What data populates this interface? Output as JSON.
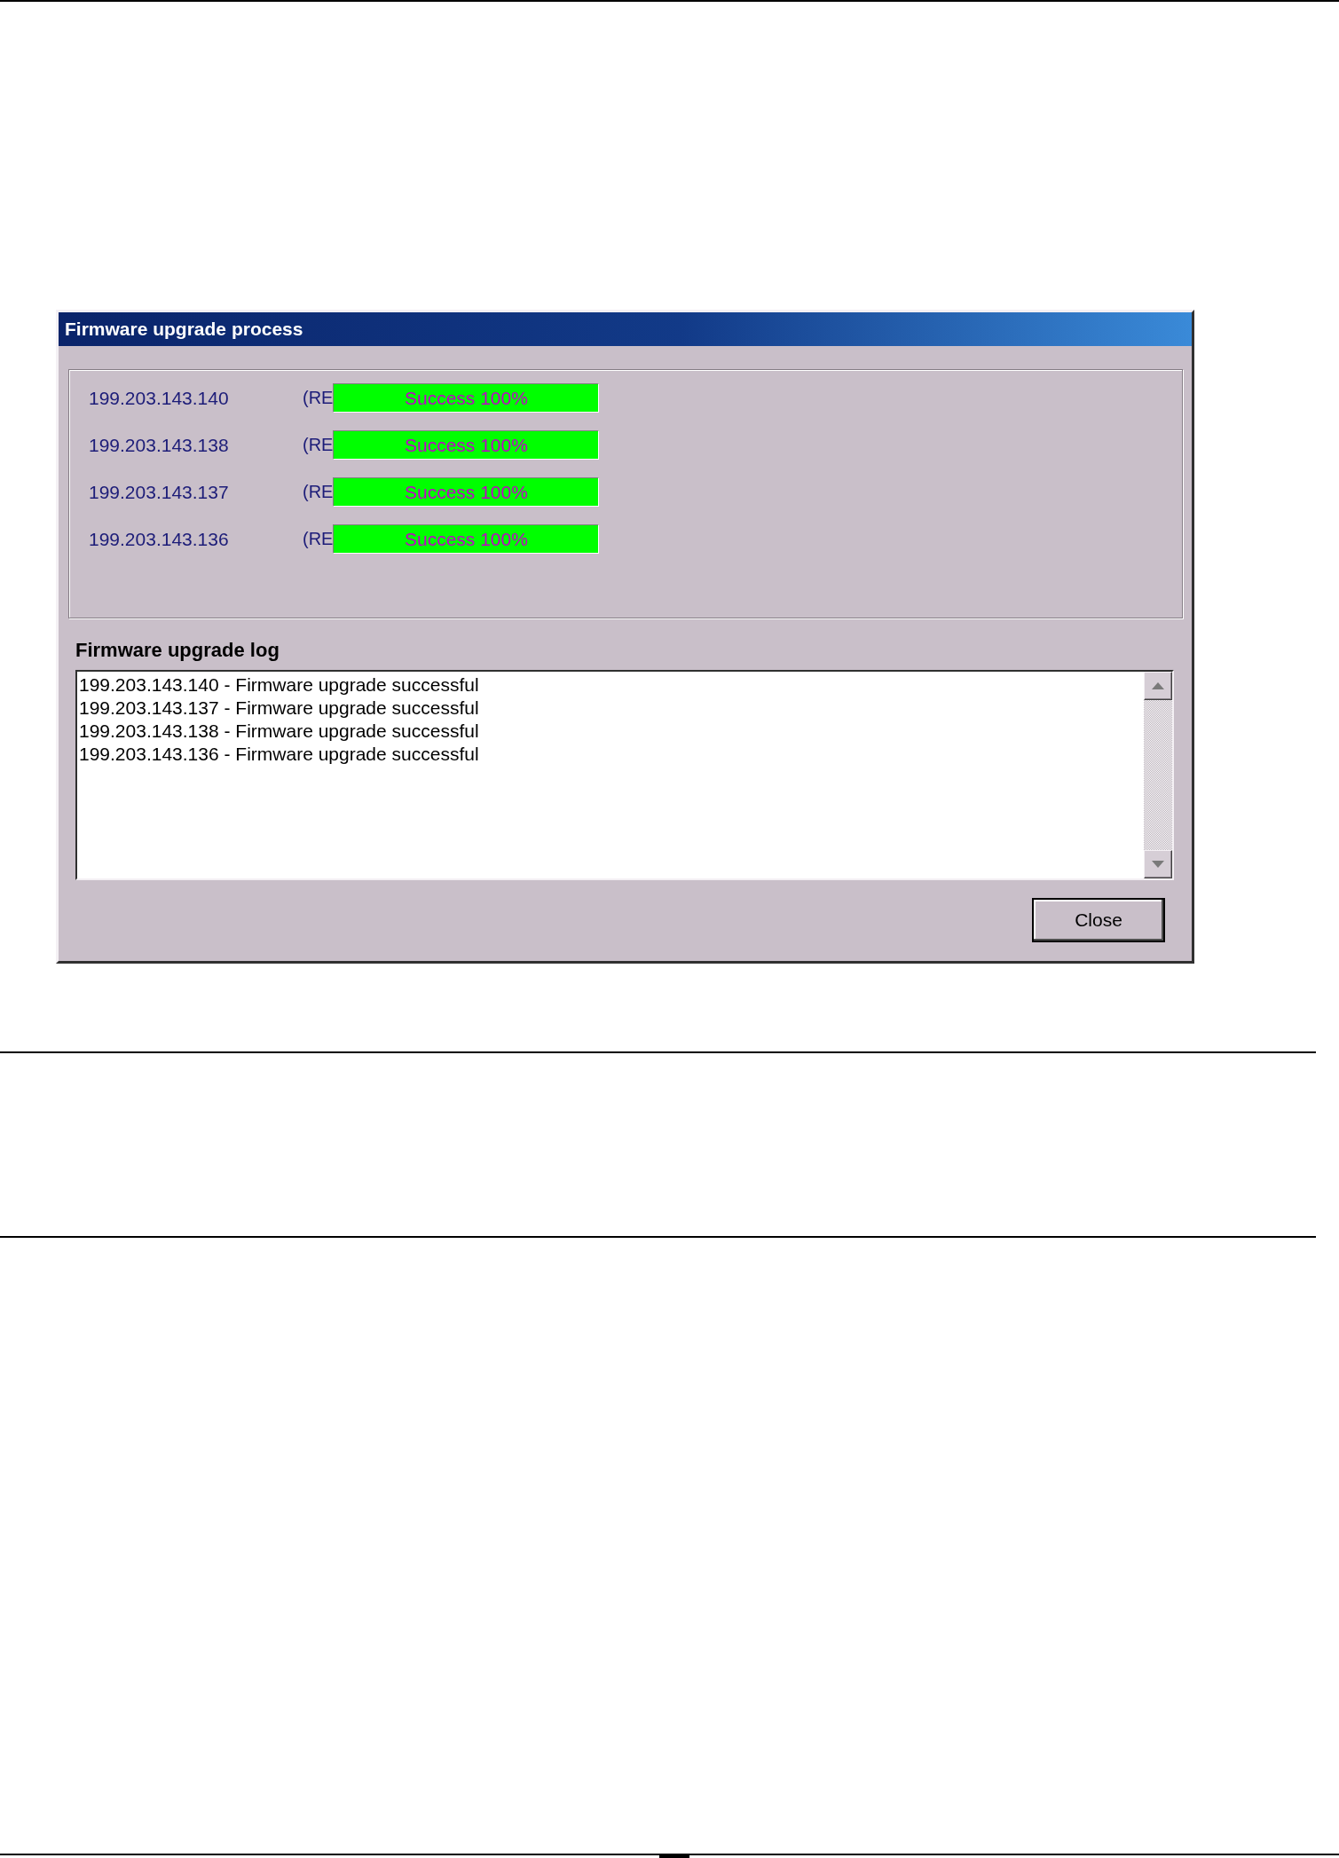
{
  "dialog": {
    "title": "Firmware upgrade process",
    "devices": [
      {
        "ip": "199.203.143.140",
        "tag": "(RE",
        "level": 1,
        "status": "Success 100%"
      },
      {
        "ip": "199.203.143.138",
        "tag": "(RE",
        "level": 1,
        "status": "Success 100%"
      },
      {
        "ip": "199.203.143.137",
        "tag": "(RE",
        "level": 1,
        "status": "Success 100%"
      },
      {
        "ip": "199.203.143.136",
        "tag": "(RE",
        "level": 1,
        "status": "Success 100%"
      }
    ],
    "log": {
      "label": "Firmware upgrade log",
      "lines": [
        "199.203.143.140 - Firmware upgrade successful",
        "199.203.143.137 - Firmware upgrade successful",
        "199.203.143.138 - Firmware upgrade successful",
        "199.203.143.136 - Firmware upgrade successful"
      ]
    },
    "buttons": [
      {
        "label": "Close",
        "default": true
      }
    ]
  }
}
